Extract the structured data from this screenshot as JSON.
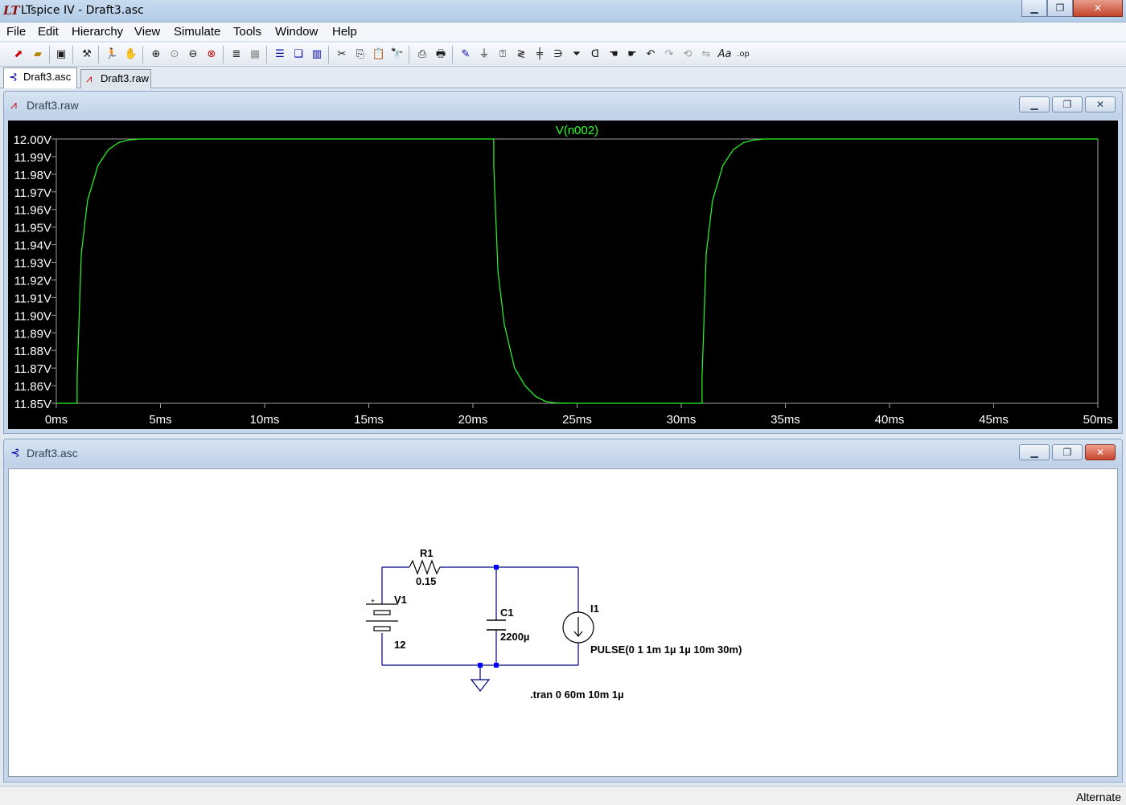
{
  "window": {
    "title": "LTspice IV - Draft3.asc",
    "minimize": "▁",
    "restore": "❐",
    "close": "✕"
  },
  "menu": [
    "File",
    "Edit",
    "Hierarchy",
    "View",
    "Simulate",
    "Tools",
    "Window",
    "Help"
  ],
  "toolbar": {
    "icons": [
      "new-schematic-icon",
      "open-icon",
      "save-icon",
      "control-panel-icon",
      "run-icon",
      "halt-icon",
      "zoom-in-icon",
      "zoom-pan-icon",
      "zoom-out-icon",
      "zoom-fit-icon",
      "autorange-icon",
      "grid-icon",
      "tile-horizontal-icon",
      "cascade-icon",
      "tile-vertical-icon",
      "cut-icon",
      "copy-icon",
      "paste-icon",
      "find-icon",
      "print-preview-icon",
      "print-icon",
      "draw-wire-icon",
      "ground-icon",
      "label-net-icon",
      "resistor-icon",
      "capacitor-icon",
      "inductor-icon",
      "diode-icon",
      "component-icon",
      "move-icon",
      "drag-icon",
      "undo-icon",
      "redo-icon",
      "rotate-icon",
      "mirror-icon",
      "text-icon",
      "spice-directive-icon"
    ]
  },
  "tabs": [
    {
      "label": "Draft3.asc",
      "active": true
    },
    {
      "label": "Draft3.raw",
      "active": false
    }
  ],
  "waveform_window": {
    "title": "Draft3.raw",
    "trace_name": "V(n002)",
    "trace_color": "#24ff24",
    "chart_data": {
      "type": "line",
      "title": "V(n002)",
      "xlabel": "",
      "ylabel": "",
      "x_ticks": [
        "0ms",
        "5ms",
        "10ms",
        "15ms",
        "20ms",
        "25ms",
        "30ms",
        "35ms",
        "40ms",
        "45ms",
        "50ms"
      ],
      "y_ticks": [
        "12.00V",
        "11.99V",
        "11.98V",
        "11.97V",
        "11.96V",
        "11.95V",
        "11.94V",
        "11.93V",
        "11.92V",
        "11.91V",
        "11.90V",
        "11.89V",
        "11.88V",
        "11.87V",
        "11.86V",
        "11.85V"
      ],
      "xlim": [
        0,
        50
      ],
      "ylim": [
        11.85,
        12.0
      ],
      "series": [
        {
          "name": "V(n002)",
          "x_units": "ms",
          "points": [
            [
              0,
              11.85
            ],
            [
              1,
              11.85
            ],
            [
              1.001,
              11.865
            ],
            [
              1.2,
              11.935
            ],
            [
              1.5,
              11.965
            ],
            [
              2.0,
              11.985
            ],
            [
              2.5,
              11.994
            ],
            [
              3.0,
              11.998
            ],
            [
              3.5,
              11.9995
            ],
            [
              4.0,
              12.0
            ],
            [
              21.0,
              12.0
            ],
            [
              21.001,
              11.985
            ],
            [
              21.2,
              11.925
            ],
            [
              21.5,
              11.895
            ],
            [
              22.0,
              11.87
            ],
            [
              22.5,
              11.86
            ],
            [
              23.0,
              11.854
            ],
            [
              23.5,
              11.851
            ],
            [
              24.0,
              11.8502
            ],
            [
              25.0,
              11.85
            ],
            [
              31.0,
              11.85
            ],
            [
              31.001,
              11.865
            ],
            [
              31.2,
              11.935
            ],
            [
              31.5,
              11.965
            ],
            [
              32.0,
              11.985
            ],
            [
              32.5,
              11.994
            ],
            [
              33.0,
              11.998
            ],
            [
              33.5,
              11.9995
            ],
            [
              34.0,
              12.0
            ],
            [
              50.0,
              12.0
            ]
          ]
        }
      ]
    }
  },
  "schematic_window": {
    "title": "Draft3.asc",
    "components": {
      "r1_name": "R1",
      "r1_value": "0.15",
      "v1_name": "V1",
      "v1_value": "12",
      "v1_plus": "+",
      "c1_name": "C1",
      "c1_value": "2200µ",
      "i1_name": "I1",
      "i1_value": "PULSE(0 1 1m 1µ 1µ 10m 30m)",
      "directive": ".tran 0 60m 10m 1µ"
    },
    "wire_color": "#000080",
    "node_color": "#0000ff"
  },
  "status": "Alternate"
}
